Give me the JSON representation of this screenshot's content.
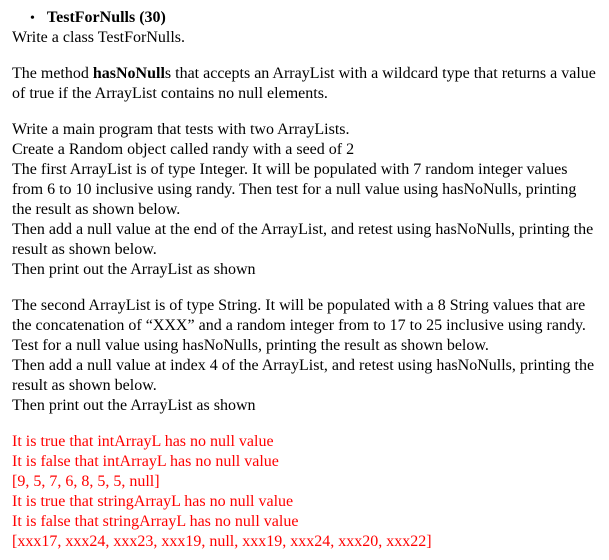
{
  "heading": {
    "bullet": "•",
    "title_prefix": "TestForNulls",
    "title_points": " (30)"
  },
  "intro": "Write a class TestForNulls.",
  "method_desc": {
    "pre": "The method ",
    "bold": "hasNoNull",
    "post": "s that accepts an ArrayList with a wildcard type that returns a value of true if the ArrayList contains no null elements."
  },
  "main1": "Write a main program that tests with two ArrayLists.",
  "main2": "Create a Random object called randy with a seed of 2",
  "main3": "The first ArrayList is of type Integer. It will be populated with 7 random integer values from 6 to 10  inclusive using randy. Then test for a null value using hasNoNulls, printing the result as shown below.",
  "main4": "Then add a null value at the end of the ArrayList, and retest using hasNoNulls, printing the result as shown below.",
  "main5": "Then print out the ArrayList as shown",
  "second1": "The second ArrayList is of type String. It will be populated with a 8 String values that are the concatenation of “XXX” and a random integer from to 17 to 25  inclusive using randy.  Test for a null value using hasNoNulls, printing the result as shown below.",
  "second2": "Then add a null value at index 4 of the ArrayList, and retest using hasNoNulls, printing the result as shown below.",
  "second3": "Then print out the ArrayList as shown",
  "output": {
    "line1": "It is true that intArrayL has no null value",
    "line2": "It is false that intArrayL has no null value",
    "line3": "[9, 5, 7, 6, 8, 5, 5, null]",
    "line4": "It is true that stringArrayL has no null value",
    "line5": "It is false that stringArrayL has no null value",
    "line6": "[xxx17, xxx24, xxx23, xxx19, null, xxx19, xxx24, xxx20, xxx22]"
  }
}
